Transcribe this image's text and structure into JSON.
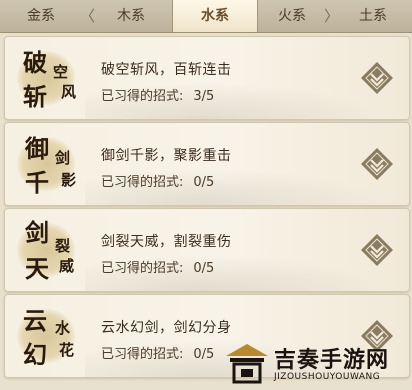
{
  "tabs": [
    {
      "label": "金系",
      "active": false
    },
    {
      "label": "木系",
      "active": false
    },
    {
      "label": "水系",
      "active": true
    },
    {
      "label": "火系",
      "active": false
    },
    {
      "label": "土系",
      "active": false
    }
  ],
  "progress_label": "已习得的招式:",
  "skills": [
    {
      "name": "破空斩风，百斩连击",
      "progress": "3/5",
      "emblem": [
        "破",
        "斩",
        "空",
        "风"
      ]
    },
    {
      "name": "御剑千影，聚影重击",
      "progress": "0/5",
      "emblem": [
        "御",
        "千",
        "剑",
        "影"
      ]
    },
    {
      "name": "剑裂天威，割裂重伤",
      "progress": "0/5",
      "emblem": [
        "剑",
        "天",
        "裂",
        "威"
      ]
    },
    {
      "name": "云水幻剑，剑幻分身",
      "progress": "0/5",
      "emblem": [
        "云",
        "幻",
        "水",
        "花"
      ]
    }
  ],
  "icons": {
    "expand": "chevron-down-icon"
  },
  "colors": {
    "accent": "#6b4e2a",
    "button": "#8a7c63"
  },
  "watermark": {
    "title": "吉奏手游网",
    "subtitle": "JIZOUSHOUYOUWANG"
  }
}
